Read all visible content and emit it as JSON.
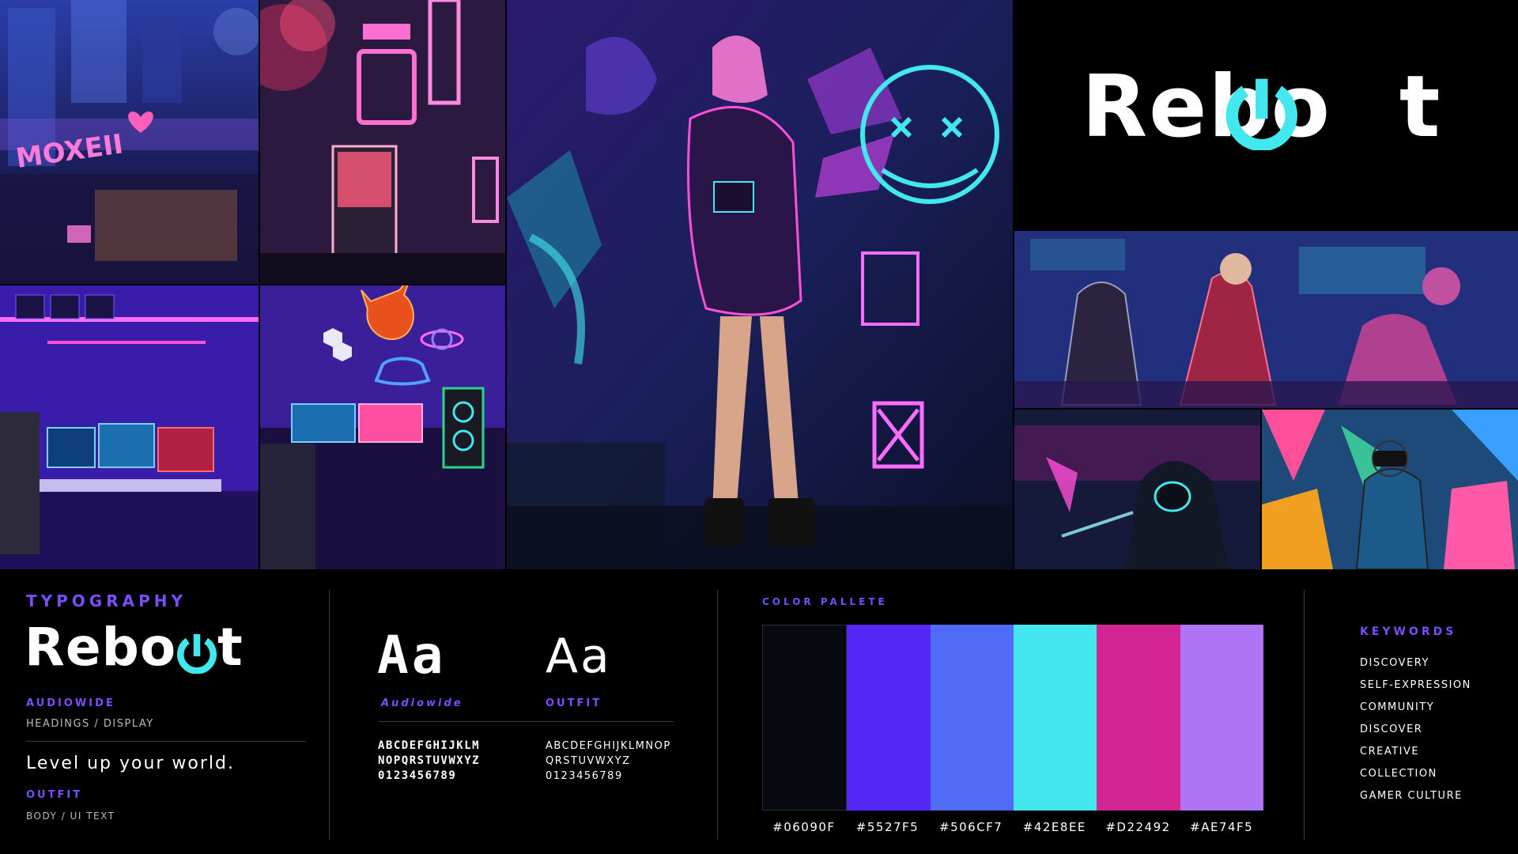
{
  "brand": {
    "logo_prefix": "Reb",
    "logo_mid": "o",
    "logo_suffix": "t",
    "logo_alt": "Reboot"
  },
  "colors": {
    "accent_purple": "#7B4DFF",
    "logo_cyan": "#42E8EE"
  },
  "typography": {
    "title": "TYPOGRAPHY",
    "headings_font": "AUDIOWIDE",
    "headings_use": "HEADINGS / DISPLAY",
    "tagline": "Level up your world.",
    "body_font": "OUTFIT",
    "body_use": "BODY / UI TEXT"
  },
  "specimens": [
    {
      "sample": "Aa",
      "name": "Audiowide",
      "glyph_line1": "ABCDEFGHIJKLM",
      "glyph_line2": "NOPQRSTUVWXYZ",
      "glyph_line3": "0123456789"
    },
    {
      "sample": "Aa",
      "name": "OUTFIT",
      "glyph_line1": "ABCDEFGHIJKLMNOP",
      "glyph_line2": "QRSTUVWXYZ",
      "glyph_line3": "0123456789"
    }
  ],
  "palette": {
    "title": "COLOR PALLETE",
    "swatches": [
      {
        "hex": "#06090F"
      },
      {
        "hex": "#5527F5"
      },
      {
        "hex": "#506CF7"
      },
      {
        "hex": "#42E8EE"
      },
      {
        "hex": "#D22492"
      },
      {
        "hex": "#AE74F5"
      }
    ]
  },
  "keywords": {
    "title": "KEYWORDS",
    "items": [
      "DISCOVERY",
      "SELF-EXPRESSION",
      "COMMUNITY",
      "DISCOVER",
      "CREATIVE",
      "COLLECTION",
      "GAMER CULTURE"
    ]
  },
  "collage": {
    "sign_text": "MOXEII"
  }
}
